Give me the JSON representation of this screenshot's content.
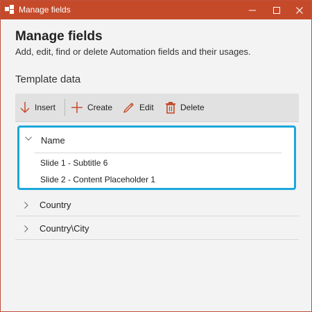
{
  "window": {
    "title": "Manage fields",
    "accent_color": "#c54a2a",
    "controls": [
      "minimize-icon",
      "maximize-icon",
      "close-icon"
    ]
  },
  "header": {
    "title": "Manage fields",
    "subtitle": "Add, edit, find or delete Automation fields and their usages."
  },
  "section": {
    "title": "Template data"
  },
  "toolbar": {
    "insert_label": "Insert",
    "create_label": "Create",
    "edit_label": "Edit",
    "delete_label": "Delete"
  },
  "fields": [
    {
      "label": "Name",
      "expanded": true,
      "selected": true,
      "usages": [
        "Slide 1 - Subtitle 6",
        "Slide 2 - Content Placeholder 1"
      ]
    },
    {
      "label": "Country",
      "expanded": false
    },
    {
      "label": "Country\\City",
      "expanded": false
    }
  ],
  "colors": {
    "selection_border": "#1aa7d9",
    "toolbar_icon": "#c54a2a"
  }
}
